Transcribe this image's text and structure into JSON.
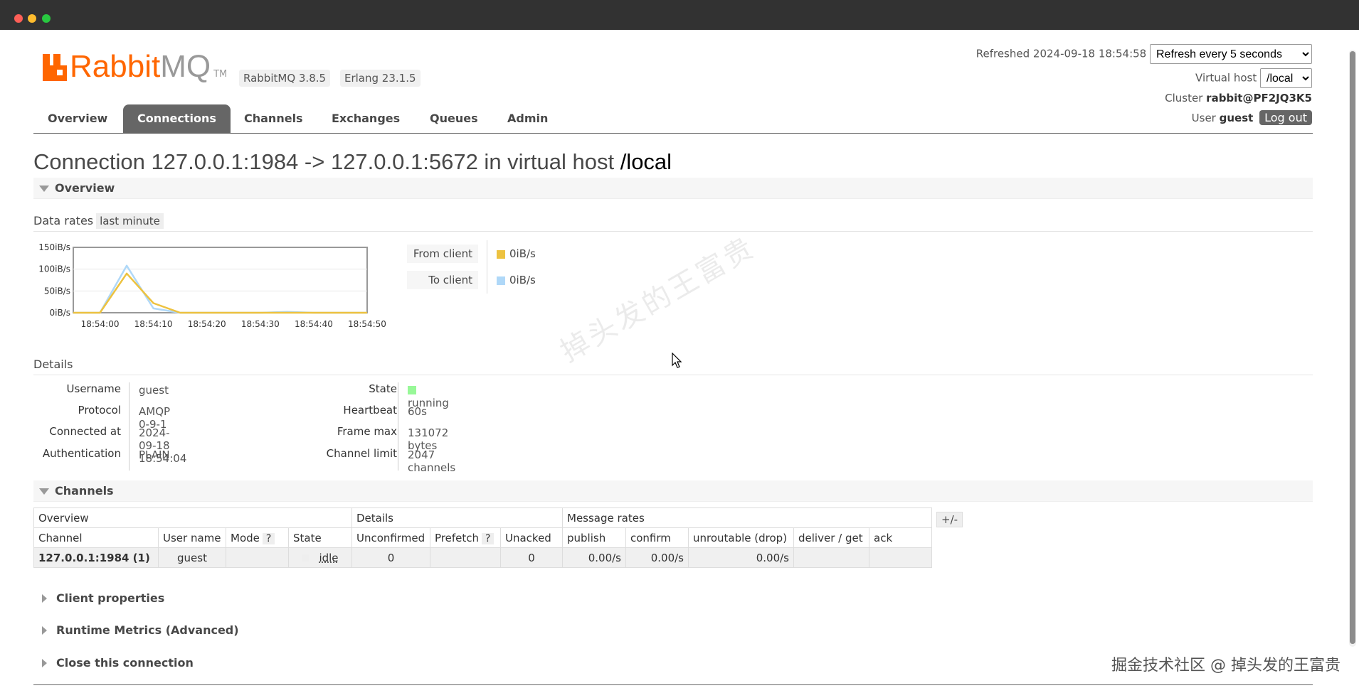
{
  "header": {
    "logo_rabbit": "Rabbit",
    "logo_mq": "MQ",
    "logo_tm": "TM",
    "rabbitmq_version": "RabbitMQ 3.8.5",
    "erlang_version": "Erlang 23.1.5",
    "refreshed_label": "Refreshed 2024-09-18 18:54:58",
    "refresh_select": "Refresh every 5 seconds",
    "virtual_host_label": "Virtual host",
    "virtual_host_value": "/local",
    "cluster_label": "Cluster",
    "cluster_value": "rabbit@PF2JQ3K5",
    "user_label": "User",
    "user_value": "guest",
    "logout_label": "Log out"
  },
  "tabs": [
    {
      "label": "Overview",
      "active": false
    },
    {
      "label": "Connections",
      "active": true
    },
    {
      "label": "Channels",
      "active": false
    },
    {
      "label": "Exchanges",
      "active": false
    },
    {
      "label": "Queues",
      "active": false
    },
    {
      "label": "Admin",
      "active": false
    }
  ],
  "page": {
    "title_prefix": "Connection 127.0.0.1:1984 -> 127.0.0.1:5672 in virtual host ",
    "title_vhost": "/local"
  },
  "overview": {
    "section_label": "Overview",
    "data_rates_label": "Data rates",
    "data_rates_range": "last minute"
  },
  "chart_data": {
    "type": "line",
    "x": [
      "18:54:00",
      "18:54:05",
      "18:54:10",
      "18:54:15",
      "18:54:20",
      "18:54:25",
      "18:54:30",
      "18:54:35",
      "18:54:40",
      "18:54:45",
      "18:54:50"
    ],
    "x_start": "18:53:55",
    "y_ticks": [
      "0iB/s",
      "50iB/s",
      "100iB/s",
      "150iB/s"
    ],
    "ylim": [
      0,
      150
    ],
    "series": [
      {
        "name": "From client",
        "color": "#edc240",
        "points": [
          0,
          0,
          90,
          22,
          0,
          0,
          0,
          0,
          0,
          0,
          0,
          0
        ]
      },
      {
        "name": "To client",
        "color": "#afd8f8",
        "points": [
          0,
          0,
          108,
          10,
          0,
          0,
          0,
          0,
          2,
          0,
          0,
          0
        ]
      }
    ],
    "legend": [
      {
        "label": "From client",
        "value": "0iB/s",
        "color": "#edc240"
      },
      {
        "label": "To client",
        "value": "0iB/s",
        "color": "#afd8f8"
      }
    ]
  },
  "details": {
    "section_label": "Details",
    "left": [
      {
        "label": "Username",
        "value": "guest"
      },
      {
        "label": "Protocol",
        "value": "AMQP 0-9-1"
      },
      {
        "label": "Connected at",
        "value": "2024-09-18 18:54:04"
      },
      {
        "label": "Authentication",
        "value": "PLAIN"
      }
    ],
    "right": [
      {
        "label": "State",
        "value": "running"
      },
      {
        "label": "Heartbeat",
        "value": "60s"
      },
      {
        "label": "Frame max",
        "value": "131072 bytes"
      },
      {
        "label": "Channel limit",
        "value": "2047 channels"
      }
    ]
  },
  "channels": {
    "section_label": "Channels",
    "group_headers": [
      "Overview",
      "Details",
      "Message rates"
    ],
    "columns": [
      "Channel",
      "User name",
      "Mode",
      "State",
      "Unconfirmed",
      "Prefetch",
      "Unacked",
      "publish",
      "confirm",
      "unroutable (drop)",
      "deliver / get",
      "ack"
    ],
    "help_marker": "?",
    "plusminus": "+/-",
    "row": {
      "channel": "127.0.0.1:1984 (1)",
      "user": "guest",
      "mode": "",
      "state": "idle",
      "unconfirmed": "0",
      "prefetch": "",
      "unacked": "0",
      "publish": "0.00/s",
      "confirm": "0.00/s",
      "unroutable": "0.00/s",
      "deliver_get": "",
      "ack": ""
    }
  },
  "collapsed_sections": [
    "Client properties",
    "Runtime Metrics (Advanced)",
    "Close this connection"
  ],
  "watermark": {
    "diagonal": "掉头发的王富贵",
    "corner": "掘金技术社区 @ 掉头发的王富贵"
  }
}
